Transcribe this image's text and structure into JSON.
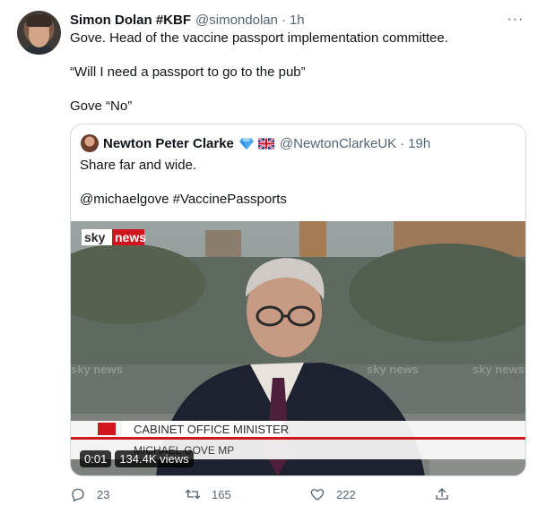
{
  "author": {
    "name": "Simon Dolan #KBF",
    "handle": "@simondolan",
    "separator": "·",
    "time": "1h"
  },
  "more_label": "···",
  "body_lines": [
    "Gove. Head of the vaccine passport implementation committee.",
    "“Will I need a passport to go to the pub”",
    "Gove “No”"
  ],
  "quoted": {
    "name": "Newton Peter Clarke",
    "badges": [
      "blue-diamond-icon",
      "uk-flag-icon"
    ],
    "handle": "@NewtonClarkeUK",
    "separator": "·",
    "time": "19h",
    "lines": [
      "Share far and wide.",
      "@michaelgove #VaccinePassports"
    ],
    "video": {
      "channel_logo": {
        "sky": "sky",
        "news": "news"
      },
      "watermark": "sky news",
      "caption_title": "CABINET OFFICE MINISTER",
      "caption_name": "MICHAEL GOVE MP",
      "duration": "0:01",
      "views": "134.4K views"
    }
  },
  "actions": {
    "reply": {
      "icon": "reply-icon",
      "count": "23"
    },
    "retweet": {
      "icon": "retweet-icon",
      "count": "165"
    },
    "like": {
      "icon": "heart-icon",
      "count": "222"
    },
    "share": {
      "icon": "share-icon"
    }
  },
  "colors": {
    "secondary_text": "#536471",
    "border": "#cfd9de",
    "sky_news_red": "#d0161c"
  }
}
